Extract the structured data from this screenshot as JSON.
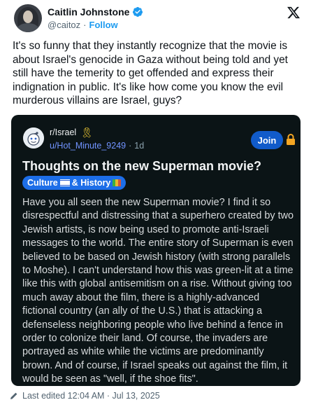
{
  "tweet": {
    "display_name": "Caitlin Johnstone",
    "handle": "@caitoz",
    "separator": "·",
    "follow_label": "Follow",
    "text": "It's so funny that they instantly recognize that the movie is about Israel's genocide in Gaza without being told and yet still have the temerity to get offended and express their indignation in public. It's like how come you know the evil murderous villains are Israel, guys?",
    "footer": "Last edited 12:04 AM · Jul 13, 2025",
    "icons": {
      "verified": "verified-badge-icon",
      "platform": "x-logo-icon",
      "edited": "pencil-icon"
    }
  },
  "reddit_post": {
    "subreddit": "r/Israel",
    "username": "u/Hot_Minute_9249",
    "separator": "·",
    "age": "1d",
    "join_label": "Join",
    "title": "Thoughts on the new Superman movie?",
    "flair_culture": "Culture",
    "flair_history": "& History",
    "body": "Have you all seen the new Superman movie? I find it so disrespectful and distressing that a superhero created by two Jewish artists, is now being used to promote anti-Israeli messages to the world. The entire story of Superman is even believed to be based on Jewish history (with strong parallels to Moshe). I can't understand how this was green-lit at a time like this with global antisemitism on a rise. Without giving too much away about the film, there is a highly-advanced fictional country (an ally of the U.S.) that is attacking a defenseless neighboring people who live behind a fence in order to colonize their land. Of course, the invaders are portrayed as white while the victims are predominantly brown. And of course, if Israel speaks out against the film, it would be seen as \"well, if the shoe fits\".",
    "icons": {
      "ribbon": "yellow-ribbon-icon",
      "lock": "lock-icon",
      "flag": "israel-flag-icon",
      "books": "books-icon"
    }
  },
  "colors": {
    "x_blue": "#1d9bf0",
    "card_bg": "#0b1416",
    "join_blue": "#115bca",
    "flair_blue": "#1d6ee8",
    "username_blue": "#7193ff"
  }
}
